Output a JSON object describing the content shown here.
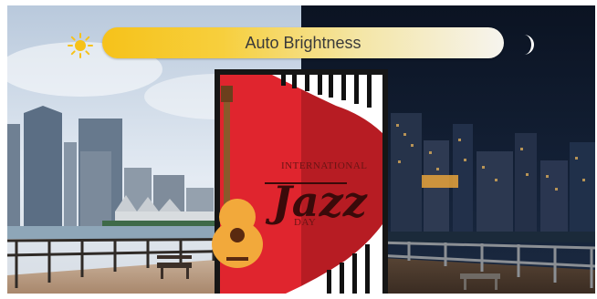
{
  "brightness": {
    "label": "Auto Brightness"
  },
  "icons": {
    "day": "sun-icon",
    "night": "crescent-moon-icon"
  },
  "poster": {
    "line1": "INTERNATIONAL",
    "line2": "Jazz",
    "line3": "DAY"
  },
  "colors": {
    "bar_start": "#f6c21a",
    "bar_end": "#f6f4ee",
    "poster_red": "#e0252e",
    "night_sky": "#0d1626"
  }
}
